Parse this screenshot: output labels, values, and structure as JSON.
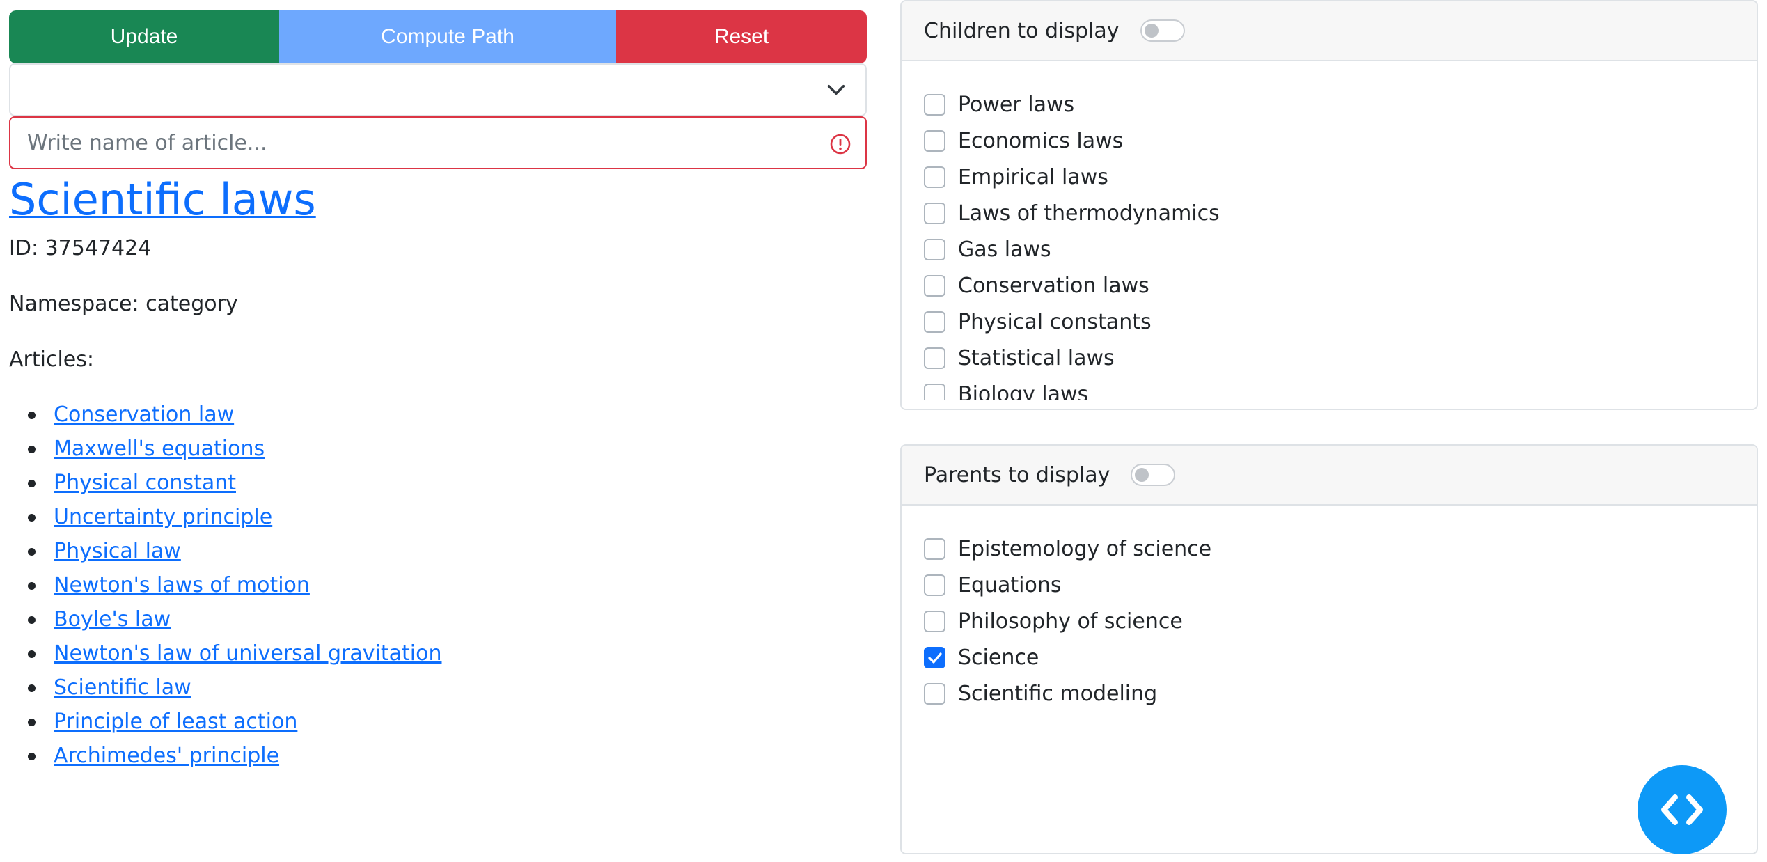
{
  "toolbar": {
    "update_label": "Update",
    "compute_path_label": "Compute Path",
    "reset_label": "Reset"
  },
  "select": {
    "value": ""
  },
  "search": {
    "placeholder": "Write name of article...",
    "value": ""
  },
  "page": {
    "title": "Scientific laws",
    "id_text": "ID: 37547424",
    "namespace_text": "Namespace: category",
    "articles_label": "Articles:",
    "articles": [
      "Conservation law",
      "Maxwell's equations",
      "Physical constant",
      "Uncertainty principle",
      "Physical law",
      "Newton's laws of motion",
      "Boyle's law",
      "Newton's law of universal gravitation",
      "Scientific law",
      "Principle of least action",
      "Archimedes' principle"
    ]
  },
  "children_panel": {
    "header": "Children to display",
    "toggle_on": false,
    "items": [
      {
        "label": "Power laws",
        "checked": false
      },
      {
        "label": "Economics laws",
        "checked": false
      },
      {
        "label": "Empirical laws",
        "checked": false
      },
      {
        "label": "Laws of thermodynamics",
        "checked": false
      },
      {
        "label": "Gas laws",
        "checked": false
      },
      {
        "label": "Conservation laws",
        "checked": false
      },
      {
        "label": "Physical constants",
        "checked": false
      },
      {
        "label": "Statistical laws",
        "checked": false
      },
      {
        "label": "Biology laws",
        "checked": false
      }
    ]
  },
  "parents_panel": {
    "header": "Parents to display",
    "toggle_on": false,
    "items": [
      {
        "label": "Epistemology of science",
        "checked": false
      },
      {
        "label": "Equations",
        "checked": false
      },
      {
        "label": "Philosophy of science",
        "checked": false
      },
      {
        "label": "Science",
        "checked": true
      },
      {
        "label": "Scientific modeling",
        "checked": false
      }
    ]
  },
  "colors": {
    "update": "#198754",
    "compute_path": "#6ea8fe",
    "reset": "#dc3545",
    "link": "#0d6efd",
    "fab": "#0d99f7"
  },
  "icons": {
    "select": "chevron-down-icon",
    "search": "exclamation-circle-icon",
    "fab": "code-brackets-icon"
  }
}
